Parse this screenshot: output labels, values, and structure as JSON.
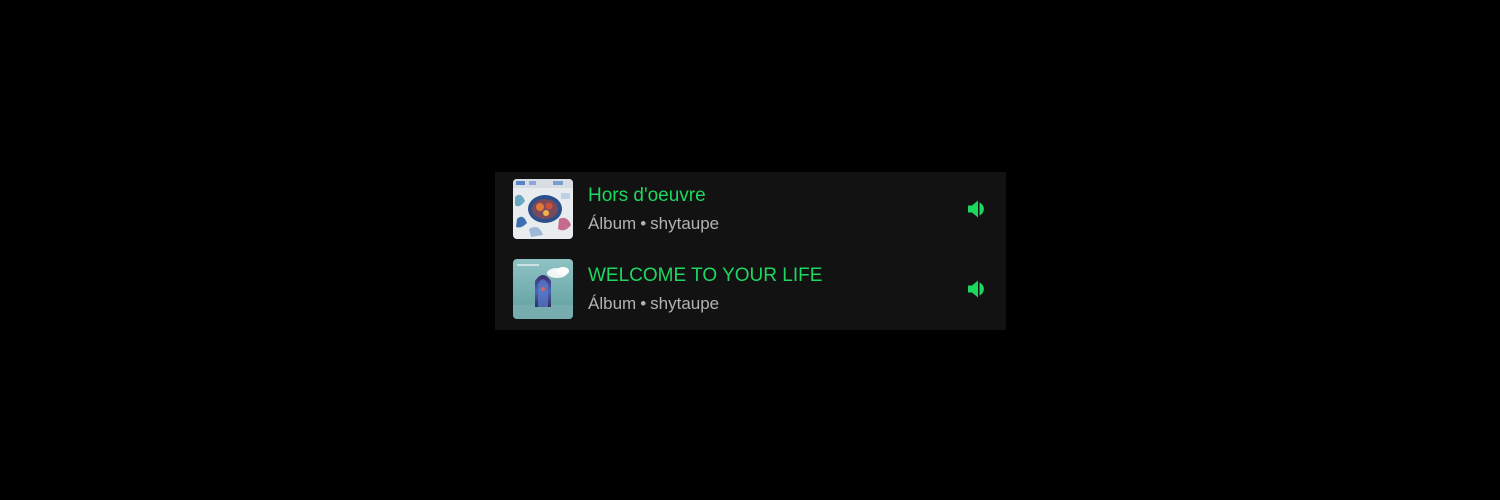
{
  "accent_color": "#1ed760",
  "list": {
    "items": [
      {
        "title": "Hors d'oeuvre",
        "type": "Álbum",
        "separator": "•",
        "artist": "shytaupe",
        "status_icon": "speaker-playing-icon",
        "cover_icon": "album-cover-hors-doeuvre"
      },
      {
        "title": "WELCOME TO YOUR LIFE",
        "type": "Álbum",
        "separator": "•",
        "artist": "shytaupe",
        "status_icon": "speaker-playing-icon",
        "cover_icon": "album-cover-welcome-to-your-life"
      }
    ]
  }
}
